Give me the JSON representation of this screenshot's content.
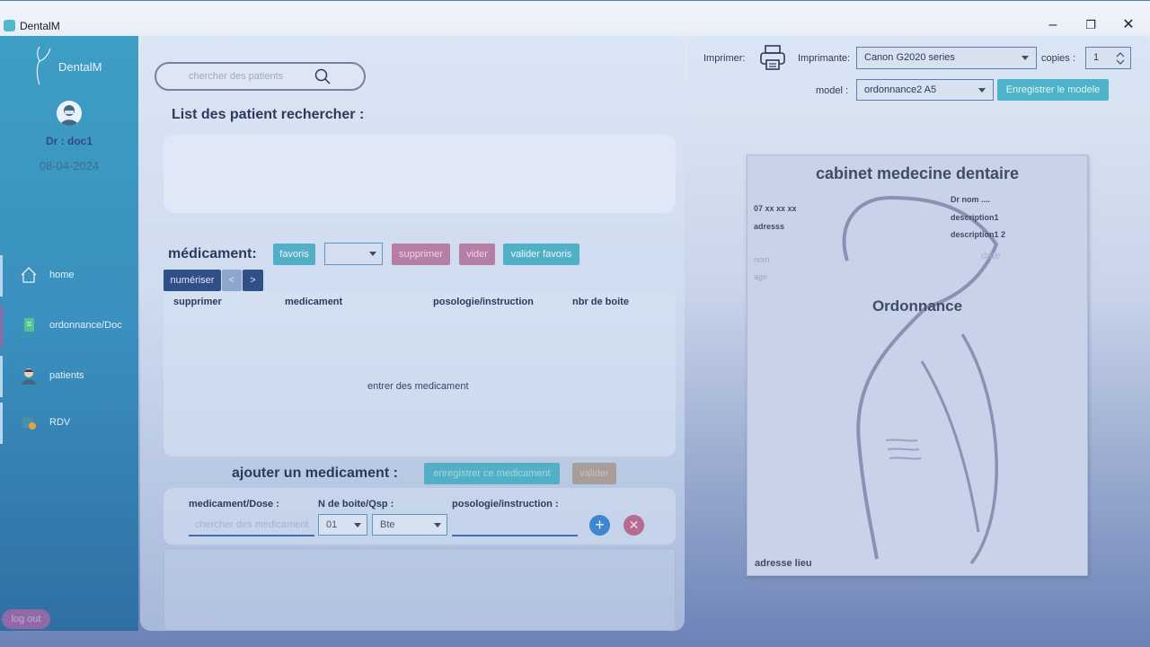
{
  "window": {
    "title": "DentalM",
    "minimize": "–",
    "restore": "❐",
    "close": "✕"
  },
  "sidebar": {
    "logo": "DentalM",
    "doctor": "Dr : doc1",
    "date": "08-04-2024",
    "items": [
      {
        "label": "home",
        "icon": "home-icon"
      },
      {
        "label": "ordonnance/Doc",
        "icon": "document-icon"
      },
      {
        "label": "patients",
        "icon": "patient-icon"
      },
      {
        "label": "RDV",
        "icon": "calendar-icon"
      }
    ],
    "logout": "log out"
  },
  "search": {
    "placeholder": "chercher des patients"
  },
  "patients": {
    "title": "List des patient rechercher :"
  },
  "medication": {
    "title": "médicament:",
    "favoris": "favoris",
    "favoris_value": "",
    "supprimer": "supprimer",
    "vider": "vider",
    "valider_favoris": "valider favoris",
    "numeriser": "numériser",
    "prev": "<",
    "next": ">",
    "columns": [
      "supprimer",
      "medicament",
      "posologie/instruction",
      "nbr de boite"
    ],
    "empty": "entrer des medicament"
  },
  "add_medication": {
    "title": "ajouter un medicament :",
    "save": "enregistrer ce medicament",
    "valider": "valider",
    "med_label": "medicament/Dose :",
    "med_placeholder": "chercher des medicament",
    "boite_label": "N de boite/Qsp :",
    "boite_value": "01",
    "unit_value": "Bte",
    "posologie_label": "posologie/instruction  :",
    "add": "+",
    "remove": "✕"
  },
  "print": {
    "imprimer": "Imprimer:",
    "imprimante_label": "Imprimante:",
    "imprimante_value": "Canon G2020 series",
    "copies_label": "copies :",
    "copies_value": "1",
    "model_label": "model :",
    "model_value": "ordonnance2 A5",
    "save_model": "Enregistrer le modele"
  },
  "preview": {
    "cabinet": "cabinet medecine dentaire",
    "phone": "07 xx xx xx",
    "address": "adresss",
    "dr_nom": "Dr nom ....",
    "description1": "description1",
    "description2": "description1 2",
    "nom": "nom",
    "age": "age",
    "date": "date",
    "ordonnance": "Ordonnance",
    "adresse_lieu": "adresse lieu"
  },
  "colors": {
    "sidebar": "#3a8fbe",
    "accent_teal": "#52b0c6",
    "accent_pink": "#b67ea5",
    "primary_dark": "#2f4f86"
  }
}
